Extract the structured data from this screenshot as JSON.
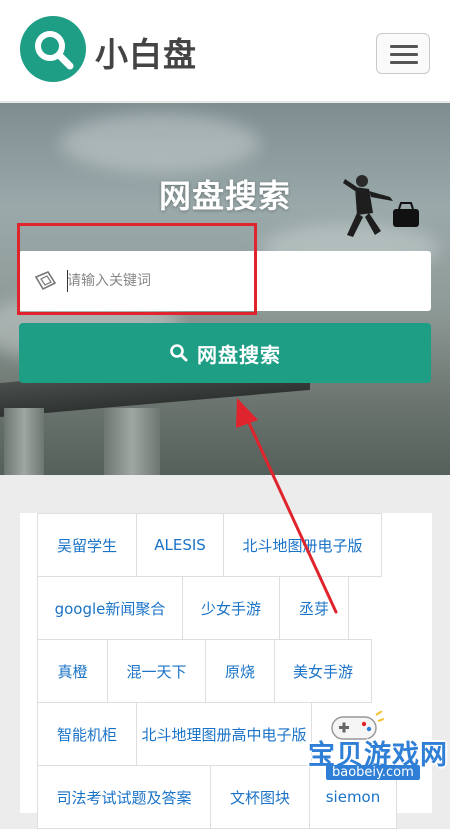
{
  "header": {
    "brand": "小白盘",
    "logo_icon": "search-icon",
    "menu_icon": "hamburger-icon",
    "accent": "#1f9e86"
  },
  "hero": {
    "title": "网盘搜索",
    "search": {
      "placeholder": "请输入关键词",
      "value": "",
      "icon": "keyboard-icon"
    },
    "button_label": "网盘搜索",
    "button_icon": "search-icon"
  },
  "tags": [
    "吴留学生",
    "ALESIS",
    "北斗地图册电子版",
    "google新闻聚合",
    "少女手游",
    "丞芽",
    "真橙",
    "混一天下",
    "原烧",
    "美女手游",
    "智能机柜",
    "北斗地理图册高中电子版",
    "司法考试试题及答案",
    "文杯图块",
    "siemon"
  ],
  "watermark": {
    "text": "宝贝游戏网",
    "url": "baobeiy.com"
  }
}
